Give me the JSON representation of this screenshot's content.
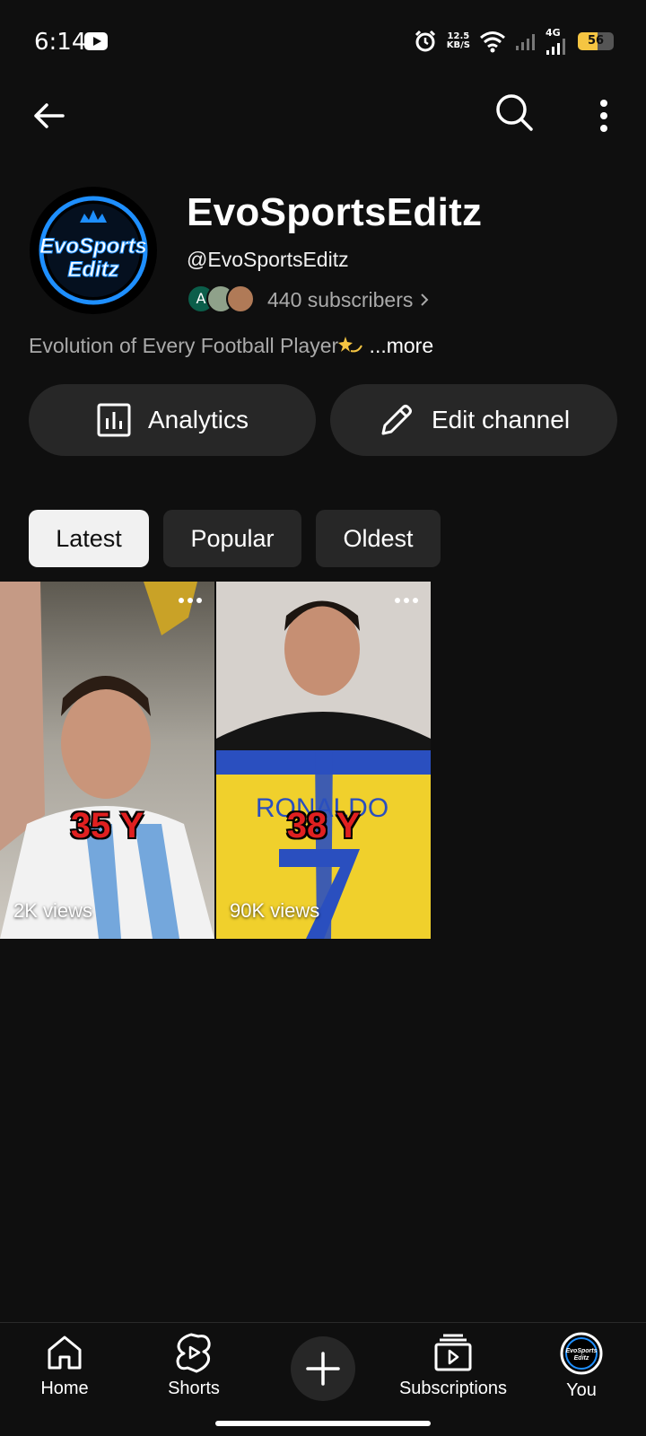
{
  "status_bar": {
    "time": "6:14",
    "net_speed_value": "12.5",
    "net_speed_unit": "KB/S",
    "network_type": "4G",
    "battery": "56",
    "battery_level": 0.56
  },
  "channel": {
    "name": "EvoSportsEditz",
    "handle": "@EvoSportsEditz",
    "subscriber_avatar_initial": "A",
    "subscribers": "440 subscribers",
    "description": "Evolution of Every Football Player",
    "more_label": " ...more",
    "avatar_logo": "EvoSports Editz"
  },
  "actions": {
    "analytics_label": "Analytics",
    "edit_label": "Edit channel"
  },
  "sort_chips": {
    "latest": "Latest",
    "popular": "Popular",
    "oldest": "Oldest",
    "active": "Latest"
  },
  "shorts": [
    {
      "overlay_text": "35 Y",
      "views": "2K views"
    },
    {
      "overlay_text": "38 Y",
      "views": "90K views",
      "jersey_text": "RONALDO"
    }
  ],
  "bottom_nav": {
    "home": "Home",
    "shorts": "Shorts",
    "subscriptions": "Subscriptions",
    "you": "You"
  },
  "colors": {
    "background": "#0f0f0f",
    "chip_bg": "#272727",
    "chip_active_bg": "#f1f1f1",
    "secondary_text": "#aaaaaa",
    "overlay_red": "#e02020",
    "logo_blue": "#1e8fff"
  }
}
